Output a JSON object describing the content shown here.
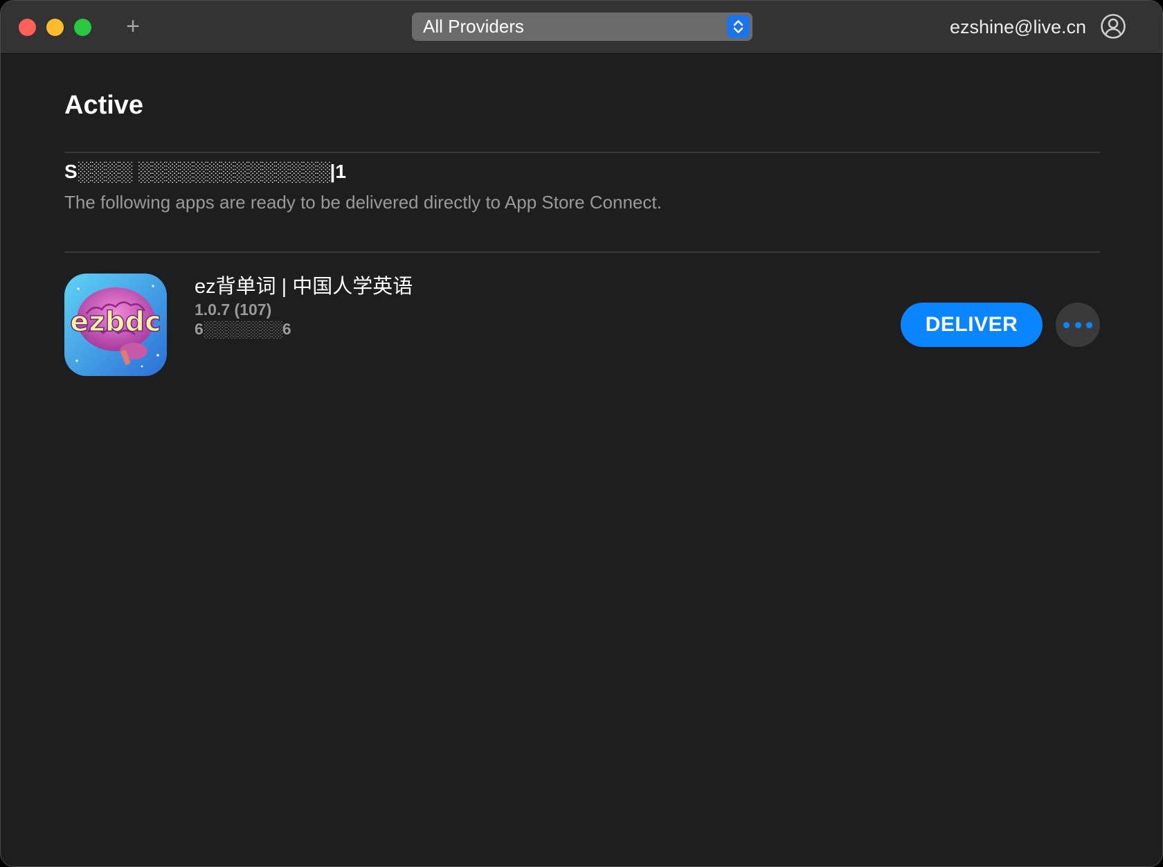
{
  "titlebar": {
    "add_symbol": "+",
    "provider_select": {
      "selected": "All Providers"
    },
    "account_email": "ezshine@live.cn"
  },
  "main": {
    "section_title": "Active",
    "provider": {
      "name": "S░░░░ ░░░░░░░░░░░░░░|1",
      "description": "The following apps are ready to be delivered directly to App Store Connect."
    },
    "app": {
      "icon_text": "ezbdc",
      "name": "ez背单词 | 中国人学英语",
      "version": "1.0.7 (107)",
      "apple_id": "6░░░░░░░6",
      "deliver_label": "DELIVER"
    }
  },
  "colors": {
    "accent": "#0a84ff",
    "window_bg": "#1e1e1e",
    "titlebar_bg": "#333333",
    "traffic_close": "#ff5f57",
    "traffic_minimize": "#febc2e",
    "traffic_zoom": "#28c840"
  },
  "icons": [
    "close-icon",
    "minimize-icon",
    "zoom-icon",
    "plus-icon",
    "chevron-up-down-icon",
    "account-icon",
    "more-icon"
  ]
}
